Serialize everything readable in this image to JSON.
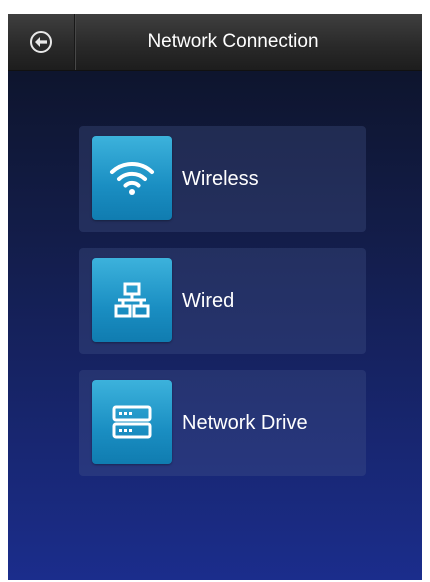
{
  "header": {
    "title": "Network Connection",
    "back_icon": "back-arrow-circle-icon"
  },
  "menu": {
    "items": [
      {
        "label": "Wireless",
        "icon": "wifi-icon"
      },
      {
        "label": "Wired",
        "icon": "wired-network-icon"
      },
      {
        "label": "Network Drive",
        "icon": "network-drive-icon"
      }
    ]
  },
  "colors": {
    "tile": "#1a8ec2",
    "background_top": "#0c1224",
    "background_bottom": "#1b2d8c",
    "titlebar": "#2a2a2a"
  }
}
